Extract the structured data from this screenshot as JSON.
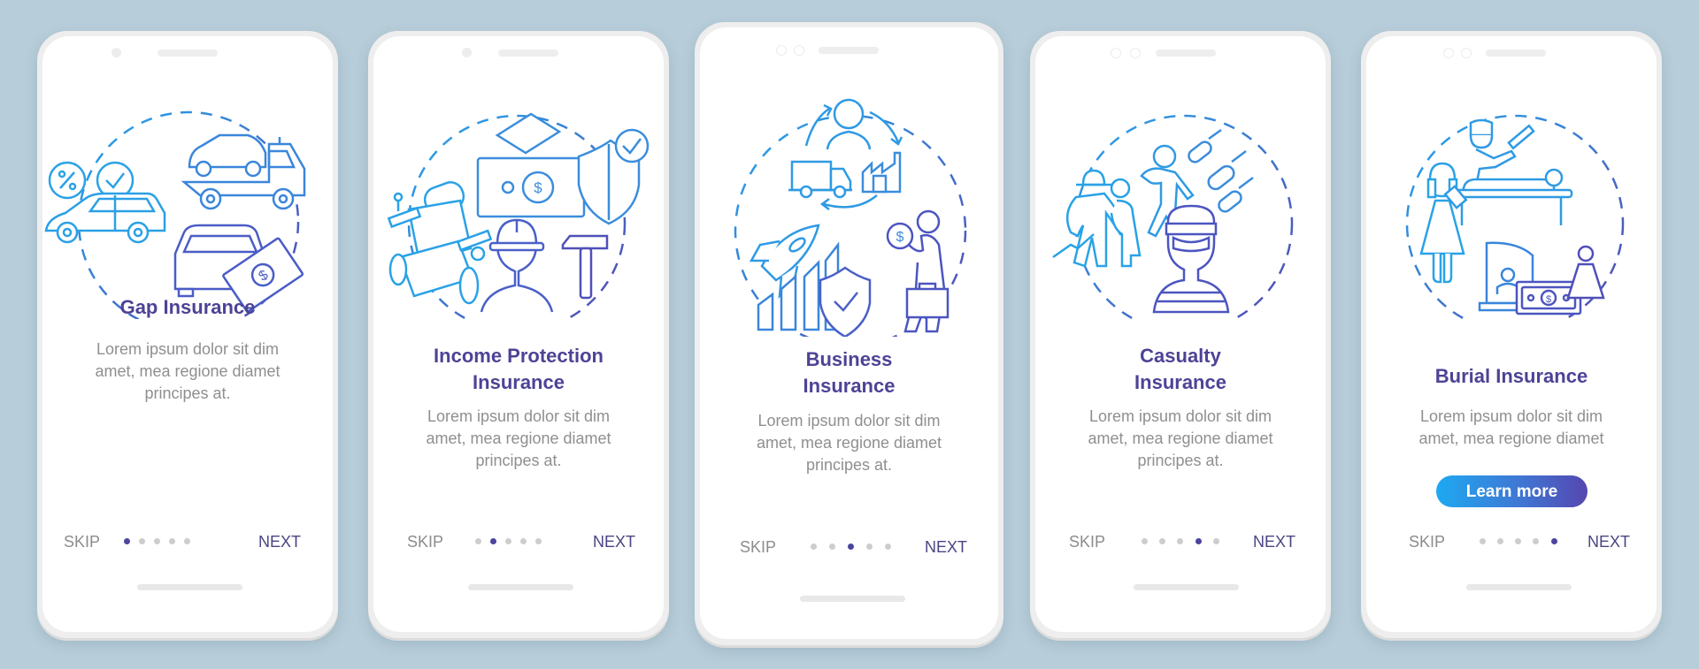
{
  "colors": {
    "background": "#b7cdd9",
    "title": "#4c4396",
    "body_text": "#8f8f8f",
    "dot_active": "#4b45a0",
    "dot_inactive": "#cdcdcd",
    "accent_gradient_start": "#1ea9f1",
    "accent_gradient_end": "#5547b0"
  },
  "screens": [
    {
      "title_lines": [
        "Gap Insurance"
      ],
      "body_lines": [
        "Lorem ipsum dolor sit dim",
        "amet, mea regione diamet",
        "principes at."
      ],
      "illustration": [
        "percent-badge-icon",
        "checkmark-badge-icon",
        "car-icon",
        "tow-truck-icon",
        "car-with-banknote-icon"
      ],
      "skip_label": "SKIP",
      "next_label": "NEXT",
      "page_index": 1,
      "page_count": 5
    },
    {
      "title_lines": [
        "Income Protection",
        "Insurance"
      ],
      "body_lines": [
        "Lorem ipsum dolor sit dim",
        "amet, mea regione diamet",
        "principes at."
      ],
      "illustration": [
        "wheelchair-icon",
        "money-shield-check-icon",
        "construction-worker-icon",
        "hammer-icon"
      ],
      "skip_label": "SKIP",
      "next_label": "NEXT",
      "page_index": 2,
      "page_count": 5
    },
    {
      "title_lines": [
        "Business",
        "Insurance"
      ],
      "body_lines": [
        "Lorem ipsum dolor sit dim",
        "amet, mea regione diamet",
        "principes at."
      ],
      "illustration": [
        "person-icon",
        "delivery-truck-icon",
        "factory-icon",
        "cycle-arrows-icon",
        "rocket-icon",
        "growth-bars-icon",
        "shield-check-icon",
        "businessman-coin-icon"
      ],
      "skip_label": "SKIP",
      "next_label": "NEXT",
      "page_index": 3,
      "page_count": 5
    },
    {
      "title_lines": [
        "Casualty",
        "Insurance"
      ],
      "body_lines": [
        "Lorem ipsum dolor sit dim",
        "amet, mea regione diamet",
        "principes at."
      ],
      "illustration": [
        "electric-shock-people-icon",
        "person-fleeing-bombs-icon",
        "bombs-icon",
        "burglar-icon"
      ],
      "skip_label": "SKIP",
      "next_label": "NEXT",
      "page_index": 4,
      "page_count": 5
    },
    {
      "title_lines": [
        "Burial Insurance"
      ],
      "body_lines": [
        "Lorem ipsum dolor sit dim",
        "amet, mea regione diamet"
      ],
      "illustration": [
        "crying-woman-icon",
        "embalmer-table-icon",
        "tombstone-icon",
        "banknote-icon",
        "mourner-icon"
      ],
      "button_label": "Learn more",
      "skip_label": "SKIP",
      "next_label": "NEXT",
      "page_index": 5,
      "page_count": 5
    }
  ]
}
